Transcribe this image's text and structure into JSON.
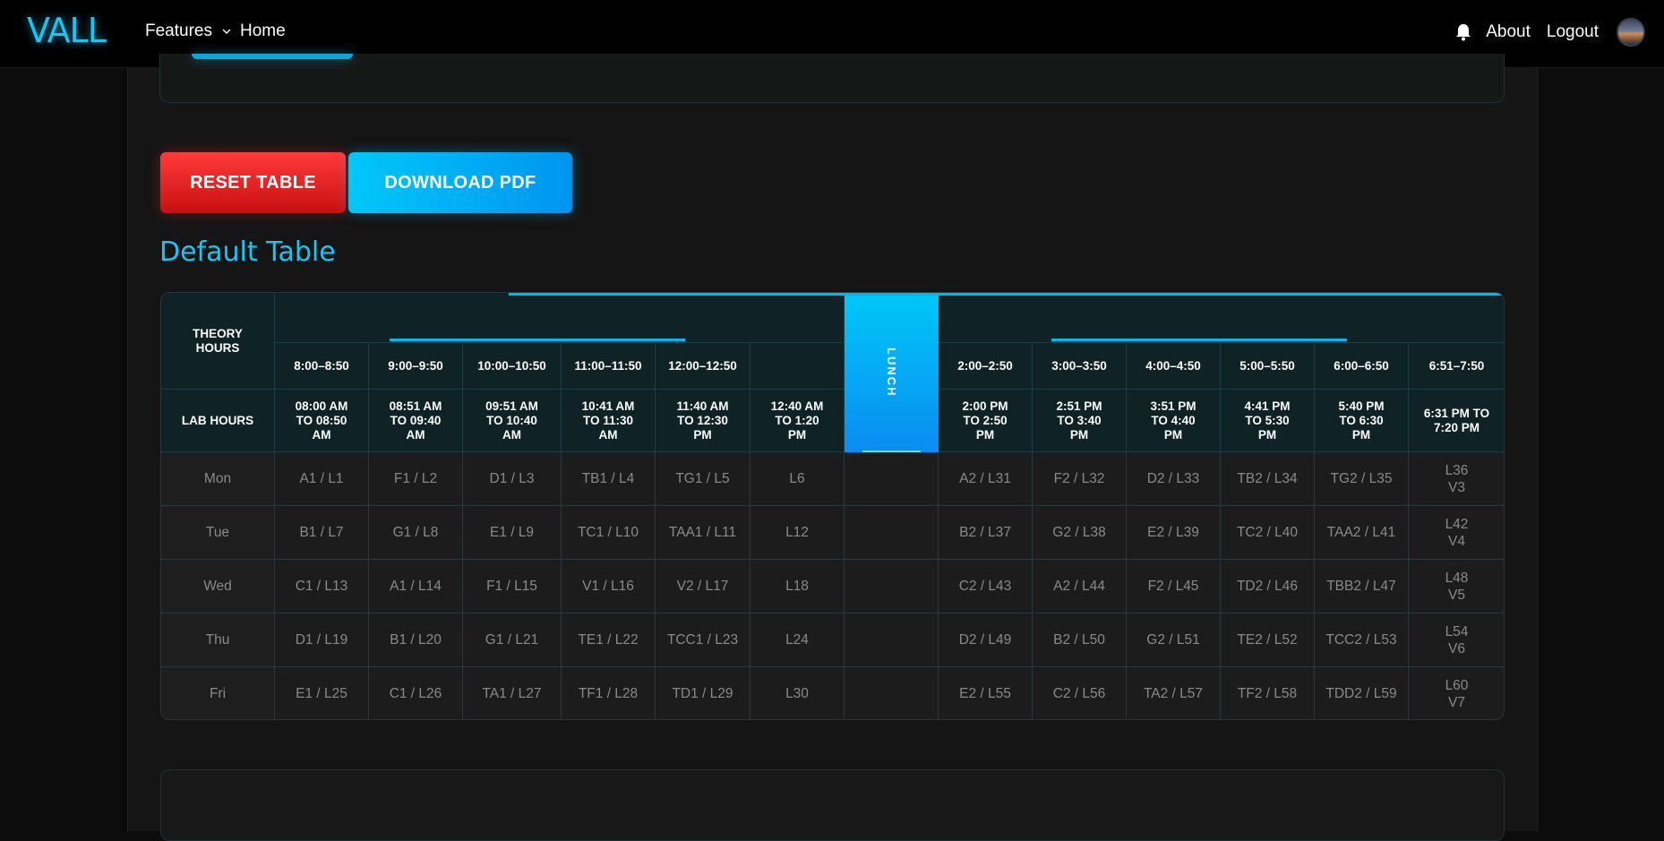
{
  "navbar": {
    "logo": "VALL",
    "features_label": "Features",
    "home_label": "Home",
    "about_label": "About",
    "logout_label": "Logout"
  },
  "actions": {
    "reset_label": "RESET TABLE",
    "download_label": "DOWNLOAD PDF"
  },
  "section_title": "Default Table",
  "timetable": {
    "theory_header": "THEORY HOURS",
    "lab_header": "LAB HOURS",
    "lunch_label": "LUNCH",
    "theory_slots": [
      "8:00–8:50",
      "9:00–9:50",
      "10:00–10:50",
      "11:00–11:50",
      "12:00–12:50",
      "",
      "2:00–2:50",
      "3:00–3:50",
      "4:00–4:50",
      "5:00–5:50",
      "6:00–6:50",
      "6:51–7:50"
    ],
    "lab_slots": [
      "08:00 AM TO 08:50 AM",
      "08:51 AM TO 09:40 AM",
      "09:51 AM TO 10:40 AM",
      "10:41 AM TO 11:30 AM",
      "11:40 AM TO 12:30 PM",
      "12:40 AM TO 1:20 PM",
      "2:00 PM TO 2:50 PM",
      "2:51 PM TO 3:40 PM",
      "3:51 PM TO 4:40 PM",
      "4:41 PM TO 5:30 PM",
      "5:40 PM TO 6:30 PM",
      "6:31 PM TO 7:20 PM"
    ],
    "rows": [
      {
        "day": "Mon",
        "cells": [
          "A1 / L1",
          "F1 / L2",
          "D1 / L3",
          "TB1 / L4",
          "TG1 / L5",
          "L6",
          "A2 / L31",
          "F2 / L32",
          "D2 / L33",
          "TB2 / L34",
          "TG2 / L35",
          "L36\nV3"
        ]
      },
      {
        "day": "Tue",
        "cells": [
          "B1 / L7",
          "G1 / L8",
          "E1 / L9",
          "TC1 / L10",
          "TAA1 / L11",
          "L12",
          "B2 / L37",
          "G2 / L38",
          "E2 / L39",
          "TC2 / L40",
          "TAA2 / L41",
          "L42\nV4"
        ]
      },
      {
        "day": "Wed",
        "cells": [
          "C1 / L13",
          "A1 / L14",
          "F1 / L15",
          "V1 / L16",
          "V2 / L17",
          "L18",
          "C2 / L43",
          "A2 / L44",
          "F2 / L45",
          "TD2 / L46",
          "TBB2 / L47",
          "L48\nV5"
        ]
      },
      {
        "day": "Thu",
        "cells": [
          "D1 / L19",
          "B1 / L20",
          "G1 / L21",
          "TE1 / L22",
          "TCC1 / L23",
          "L24",
          "D2 / L49",
          "B2 / L50",
          "G2 / L51",
          "TE2 / L52",
          "TCC2 / L53",
          "L54\nV6"
        ]
      },
      {
        "day": "Fri",
        "cells": [
          "E1 / L25",
          "C1 / L26",
          "TA1 / L27",
          "TF1 / L28",
          "TD1 / L29",
          "L30",
          "E2 / L55",
          "C2 / L56",
          "TA2 / L57",
          "TF2 / L58",
          "TDD2 / L59",
          "L60\nV7"
        ]
      }
    ]
  }
}
